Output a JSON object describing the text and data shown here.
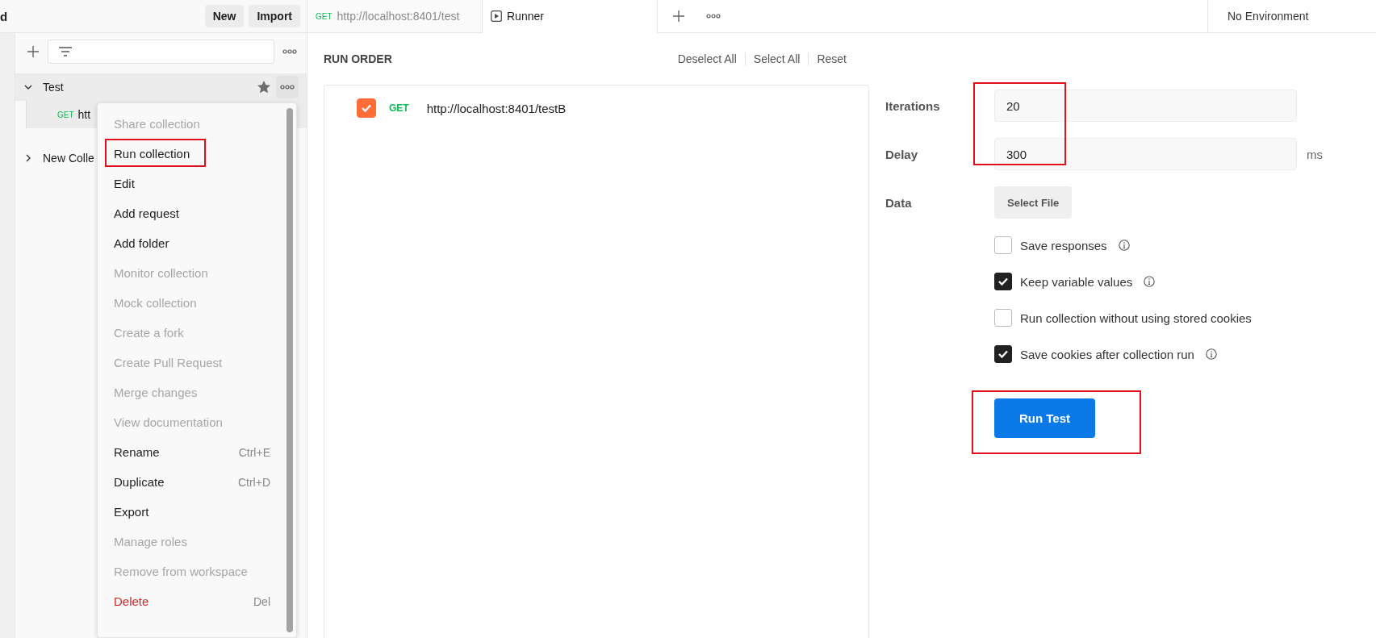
{
  "workspace": {
    "name": "d",
    "buttons": [
      {
        "label": "New"
      },
      {
        "label": "Import"
      }
    ]
  },
  "tabs": [
    {
      "kind": "request",
      "method": "GET",
      "label": "http://localhost:8401/test",
      "selected": false
    },
    {
      "kind": "runner",
      "label": "Runner",
      "selected": true
    }
  ],
  "environment": "No Environment",
  "sidebar": {
    "collections": [
      {
        "name": "Test",
        "expanded": true,
        "starred": true,
        "selected": true,
        "children": [
          {
            "method": "GET",
            "name": "htt"
          }
        ]
      },
      {
        "name": "New Colle",
        "expanded": false,
        "starred": false,
        "selected": false
      }
    ]
  },
  "context_menu": {
    "items": [
      {
        "label": "Share collection",
        "disabled": true,
        "highlighted": false
      },
      {
        "label": "Run collection",
        "disabled": false,
        "highlighted": true
      },
      {
        "label": "Edit",
        "disabled": false,
        "highlighted": false
      },
      {
        "label": "Add request",
        "disabled": false,
        "highlighted": false
      },
      {
        "label": "Add folder",
        "disabled": false,
        "highlighted": false
      },
      {
        "label": "Monitor collection",
        "disabled": true,
        "highlighted": false
      },
      {
        "label": "Mock collection",
        "disabled": true,
        "highlighted": false
      },
      {
        "label": "Create a fork",
        "disabled": true,
        "highlighted": false
      },
      {
        "label": "Create Pull Request",
        "disabled": true,
        "highlighted": false
      },
      {
        "label": "Merge changes",
        "disabled": true,
        "highlighted": false
      },
      {
        "label": "View documentation",
        "disabled": true,
        "highlighted": false
      },
      {
        "label": "Rename",
        "shortcut": "Ctrl+E",
        "disabled": false,
        "highlighted": false
      },
      {
        "label": "Duplicate",
        "shortcut": "Ctrl+D",
        "disabled": false,
        "highlighted": false
      },
      {
        "label": "Export",
        "disabled": false,
        "highlighted": false
      },
      {
        "label": "Manage roles",
        "disabled": true,
        "highlighted": false
      },
      {
        "label": "Remove from workspace",
        "disabled": true,
        "highlighted": false
      },
      {
        "label": "Delete",
        "shortcut": "Del",
        "kind": "danger",
        "disabled": false,
        "highlighted": false
      }
    ]
  },
  "runner": {
    "title": "RUN ORDER",
    "actions": [
      "Deselect All",
      "Select All",
      "Reset"
    ],
    "requests": [
      {
        "checked": true,
        "method": "GET",
        "url": "http://localhost:8401/testB"
      }
    ],
    "settings": {
      "fields_highlighted": true,
      "iterations": {
        "label": "Iterations",
        "value": "20"
      },
      "delay": {
        "label": "Delay",
        "value": "300",
        "unit": "ms"
      },
      "data": {
        "label": "Data",
        "button": "Select File"
      },
      "options": [
        {
          "label": "Save responses",
          "checked": false,
          "info": true
        },
        {
          "label": "Keep variable values",
          "checked": true,
          "info": true
        },
        {
          "label": "Run collection without using stored cookies",
          "checked": false,
          "info": false
        },
        {
          "label": "Save cookies after collection run",
          "checked": true,
          "info": true
        }
      ],
      "run_button": {
        "label": "Run Test",
        "highlighted": true
      }
    }
  }
}
